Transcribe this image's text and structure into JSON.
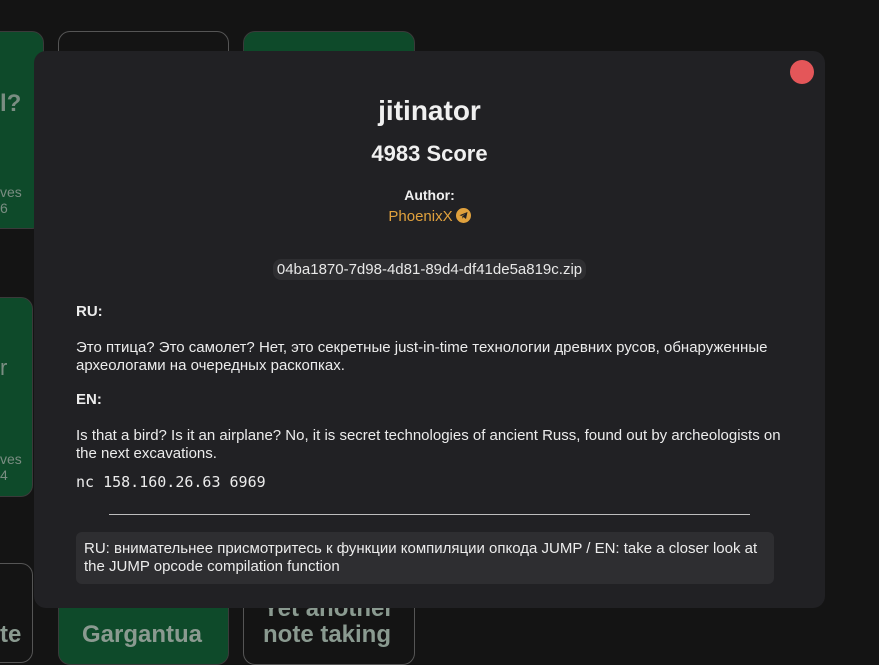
{
  "background": {
    "fragments": [
      "l?",
      "ves",
      "6",
      "r",
      "ves",
      "4",
      "te"
    ],
    "cards": [
      "Gargantua",
      "Yet another note taking"
    ]
  },
  "modal": {
    "title": "jitinator",
    "score": "4983 Score",
    "author_label": "Author:",
    "author_name": "PhoenixX",
    "author_icon": "telegram-icon",
    "file": "04ba1870-7d98-4d81-89d4-df41de5a819c.zip",
    "ru_label": "RU:",
    "ru_text": "Это птица? Это самолет? Нет, это секретные just-in-time технологии древних русов, обнаруженные археологами на очередных раскопках.",
    "en_label": "EN:",
    "en_text": "Is that a bird? Is it an airplane? No, it is secret technologies of ancient Russ, found out by archeologists on the next excavations.",
    "command": "nc 158.160.26.63 6969",
    "hint": "RU: внимательнее присмотритесь к функции компиляции опкода JUMP / EN: take a closer look at the JUMP opcode compilation function"
  },
  "colors": {
    "accent": "#e0a13d",
    "close": "#e45659",
    "modal_bg": "#212124",
    "card_green": "#0e4a2a"
  }
}
